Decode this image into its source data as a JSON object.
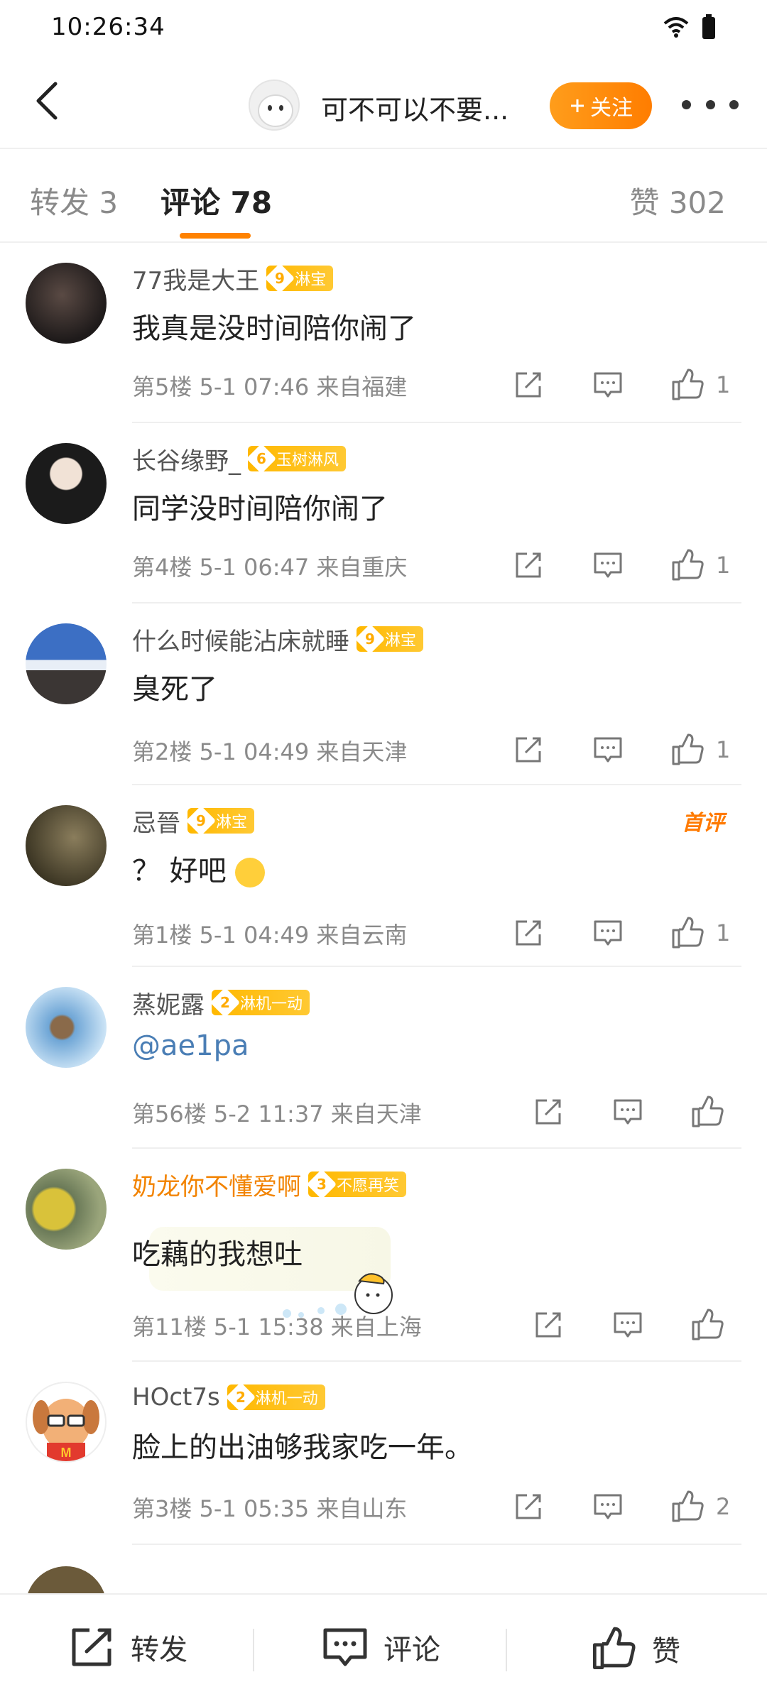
{
  "status_bar": {
    "time": "10:26:34"
  },
  "header": {
    "title": "可不可以不要...",
    "follow_label": "关注"
  },
  "tabs": {
    "repost": "转发 3",
    "comments": "评论 78",
    "likes": "赞 302"
  },
  "comments": [
    {
      "name": "77我是大王",
      "badge_level": "9",
      "badge_text": "淋宝",
      "content": "我真是没时间陪你闹了",
      "meta": "第5楼  5-1 07:46  来自福建",
      "likes": "1"
    },
    {
      "name": "长谷缘野_",
      "badge_level": "6",
      "badge_text": "玉树淋风",
      "content": "同学没时间陪你闹了",
      "meta": "第4楼  5-1 06:47  来自重庆",
      "likes": "1"
    },
    {
      "name": "什么时候能沾床就睡",
      "badge_level": "9",
      "badge_text": "淋宝",
      "content": "臭死了",
      "meta": "第2楼  5-1 04:49  来自天津",
      "likes": "1"
    },
    {
      "name": "忌晉",
      "badge_level": "9",
      "badge_text": "淋宝",
      "content": "？ 好吧",
      "meta": "第1楼  5-1 04:49  来自云南",
      "likes": "1",
      "first_tag": "首评"
    },
    {
      "name": "蒸妮露",
      "badge_level": "2",
      "badge_text": "淋机一动",
      "content": "@ae1pa",
      "meta": "第56楼  5-2 11:37  来自天津",
      "likes": ""
    },
    {
      "name": "奶龙你不懂爱啊",
      "badge_level": "3",
      "badge_text": "不愿再笑",
      "content": "吃藕的我想吐",
      "meta": "第11楼  5-1 15:38  来自上海",
      "likes": ""
    },
    {
      "name": "HOct7s",
      "badge_level": "2",
      "badge_text": "淋机一动",
      "content": "脸上的出油够我家吃一年。",
      "meta": "第3楼  5-1 05:35  来自山东",
      "likes": "2"
    }
  ],
  "bottom_bar": {
    "repost": "转发",
    "comment": "评论",
    "like": "赞"
  },
  "colors": {
    "accent": "#ff8200",
    "badge": "#ffb800",
    "link": "#4a7eb5"
  },
  "icons": [
    "back-arrow-icon",
    "wifi-icon",
    "battery-icon",
    "more-icon",
    "share-icon",
    "comment-icon",
    "thumb-up-icon"
  ]
}
